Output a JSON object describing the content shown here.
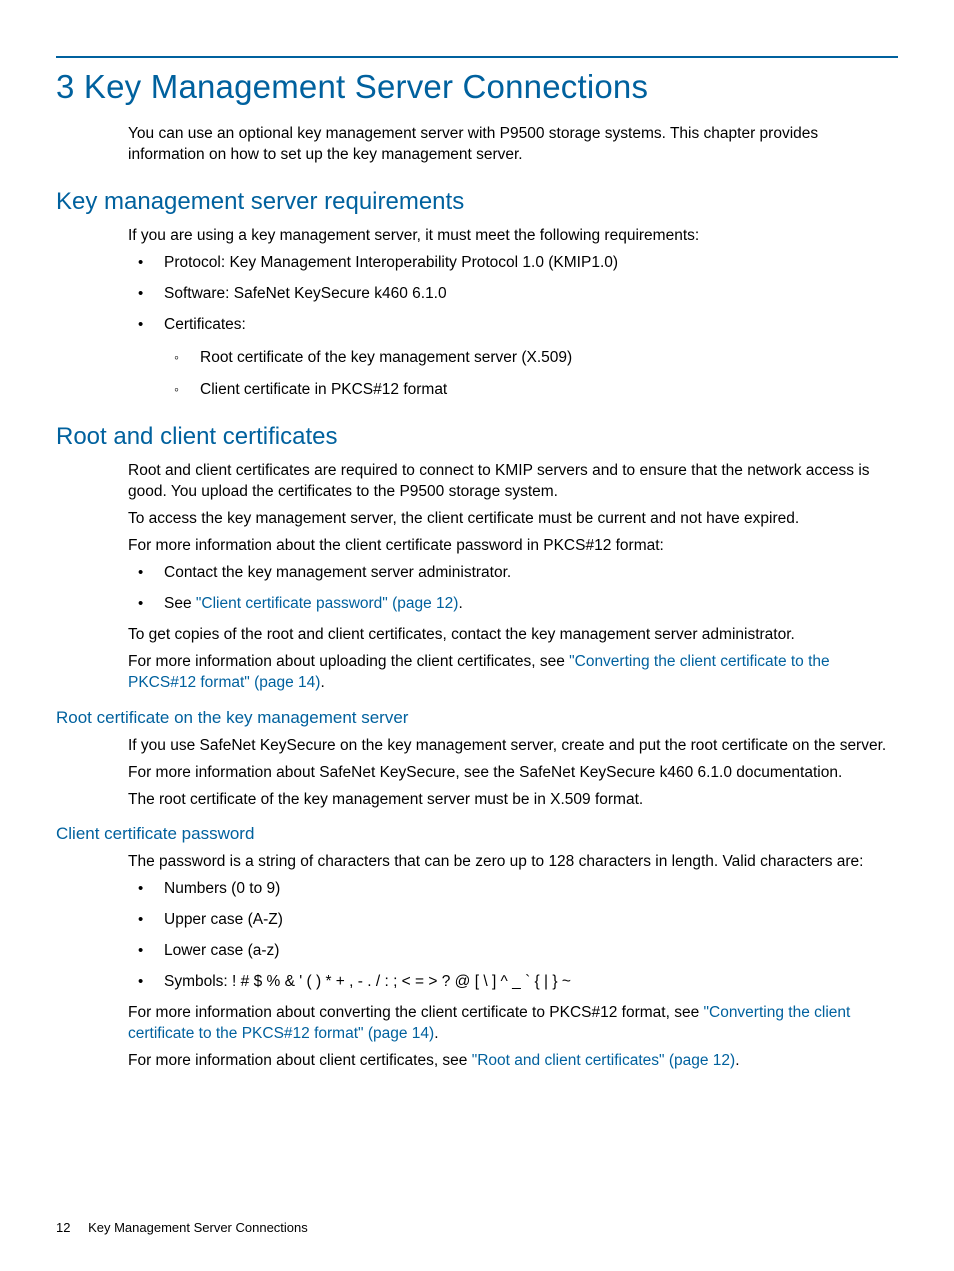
{
  "h1": "3 Key Management Server Connections",
  "intro": "You can use an optional key management server with P9500 storage systems. This chapter provides information on how to set up the key management server.",
  "s1": {
    "h2": "Key management server requirements",
    "p1": "If you are using a key management server, it must meet the following requirements:",
    "b1": "Protocol: Key Management Interoperability Protocol 1.0 (KMIP1.0)",
    "b2": "Software: SafeNet KeySecure k460 6.1.0",
    "b3": "Certificates:",
    "b3a": "Root certificate of the key management server (X.509)",
    "b3b": "Client certificate in PKCS#12 format"
  },
  "s2": {
    "h2": "Root and client certificates",
    "p1": "Root and client certificates are required to connect to KMIP servers and to ensure that the network access is good. You upload the certificates to the P9500 storage system.",
    "p2": "To access the key management server, the client certificate must be current and not have expired.",
    "p3": "For more information about the client certificate password in PKCS#12 format:",
    "b1": "Contact the key management server administrator.",
    "b2a": "See ",
    "b2link": "\"Client certificate password\" (page 12)",
    "b2b": ".",
    "p4": "To get copies of the root and client certificates, contact the key management server administrator.",
    "p5a": "For more information about uploading the client certificates, see ",
    "p5link": "\"Converting the client certificate to the PKCS#12 format\" (page 14)",
    "p5b": "."
  },
  "s3": {
    "h3": "Root certificate on the key management server",
    "p1": "If you use SafeNet KeySecure on the key management server, create and put the root certificate on the server.",
    "p2": "For more information about SafeNet KeySecure, see the SafeNet KeySecure k460 6.1.0 documentation.",
    "p3": "The root certificate of the key management server must be in X.509 format."
  },
  "s4": {
    "h3": "Client certificate password",
    "p1": "The password is a string of characters that can be zero up to 128 characters in length. Valid characters are:",
    "b1": "Numbers (0 to 9)",
    "b2": "Upper case (A-Z)",
    "b3": "Lower case (a-z)",
    "b4": "Symbols: ! # $ % & ' ( ) * + , - . / : ; < = > ? @ [ \\ ] ^ _ ` { | } ~",
    "p2a": "For more information about converting the client certificate to PKCS#12 format, see ",
    "p2link": "\"Converting the client certificate to the PKCS#12 format\" (page 14)",
    "p2b": ".",
    "p3a": "For more information about client certificates, see ",
    "p3link": "\"Root and client certificates\" (page 12)",
    "p3b": "."
  },
  "footer": {
    "page": "12",
    "title": "Key Management Server Connections"
  }
}
